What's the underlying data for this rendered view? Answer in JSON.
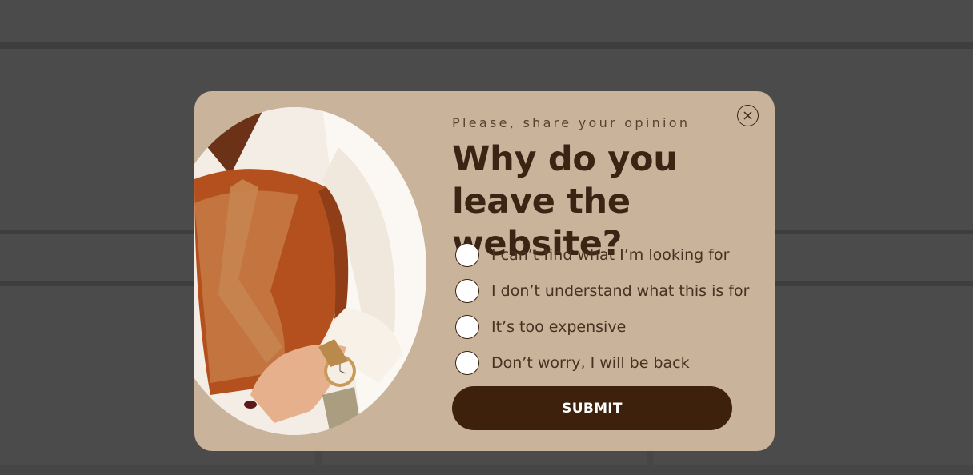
{
  "popup": {
    "eyebrow": "Please, share your opinion",
    "title": "Why do you leave the website?",
    "options": [
      {
        "label": "I can’t find what I’m looking for",
        "selected": false
      },
      {
        "label": "I don’t understand what this is for",
        "selected": false
      },
      {
        "label": "It’s too expensive",
        "selected": false
      },
      {
        "label": "Don’t worry, I will be back",
        "selected": false
      }
    ],
    "submit_label": "SUBMIT",
    "close_icon": "close-icon",
    "image": "handbag-photo"
  },
  "colors": {
    "popup_bg": "#c9b39b",
    "title": "#3c2414",
    "button_bg": "#3e210c",
    "button_text": "#ffffff",
    "page_bg": "#464646"
  }
}
